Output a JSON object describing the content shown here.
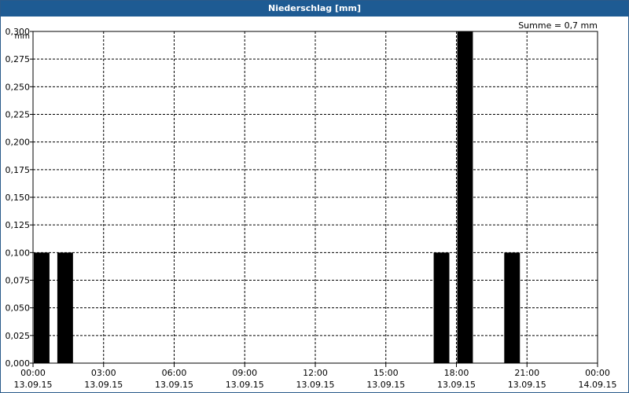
{
  "window": {
    "title": "Niederschlag [mm]"
  },
  "chart_data": {
    "type": "bar",
    "title": "Niederschlag [mm]",
    "ylabel": "mm",
    "annotation": "Summe = 0,7 mm",
    "ylim": [
      0,
      0.3
    ],
    "y_ticks": [
      "0,000",
      "0,025",
      "0,050",
      "0,075",
      "0,100",
      "0,125",
      "0,150",
      "0,175",
      "0,200",
      "0,225",
      "0,250",
      "0,275",
      "0,300"
    ],
    "xlim": [
      "13.09.15 00:00",
      "14.09.15 00:00"
    ],
    "x_ticks": [
      {
        "time": "00:00",
        "date": "13.09.15"
      },
      {
        "time": "03:00",
        "date": "13.09.15"
      },
      {
        "time": "06:00",
        "date": "13.09.15"
      },
      {
        "time": "09:00",
        "date": "13.09.15"
      },
      {
        "time": "12:00",
        "date": "13.09.15"
      },
      {
        "time": "15:00",
        "date": "13.09.15"
      },
      {
        "time": "18:00",
        "date": "13.09.15"
      },
      {
        "time": "21:00",
        "date": "13.09.15"
      },
      {
        "time": "00:00",
        "date": "14.09.15"
      }
    ],
    "x": [
      "13.09.15 00:00",
      "13.09.15 01:00",
      "13.09.15 17:00",
      "13.09.15 18:00",
      "13.09.15 20:00"
    ],
    "values": [
      0.1,
      0.1,
      0.1,
      0.3,
      0.1
    ],
    "bar_duration_hours": 1,
    "grid": true,
    "bar_color": "#000000"
  }
}
